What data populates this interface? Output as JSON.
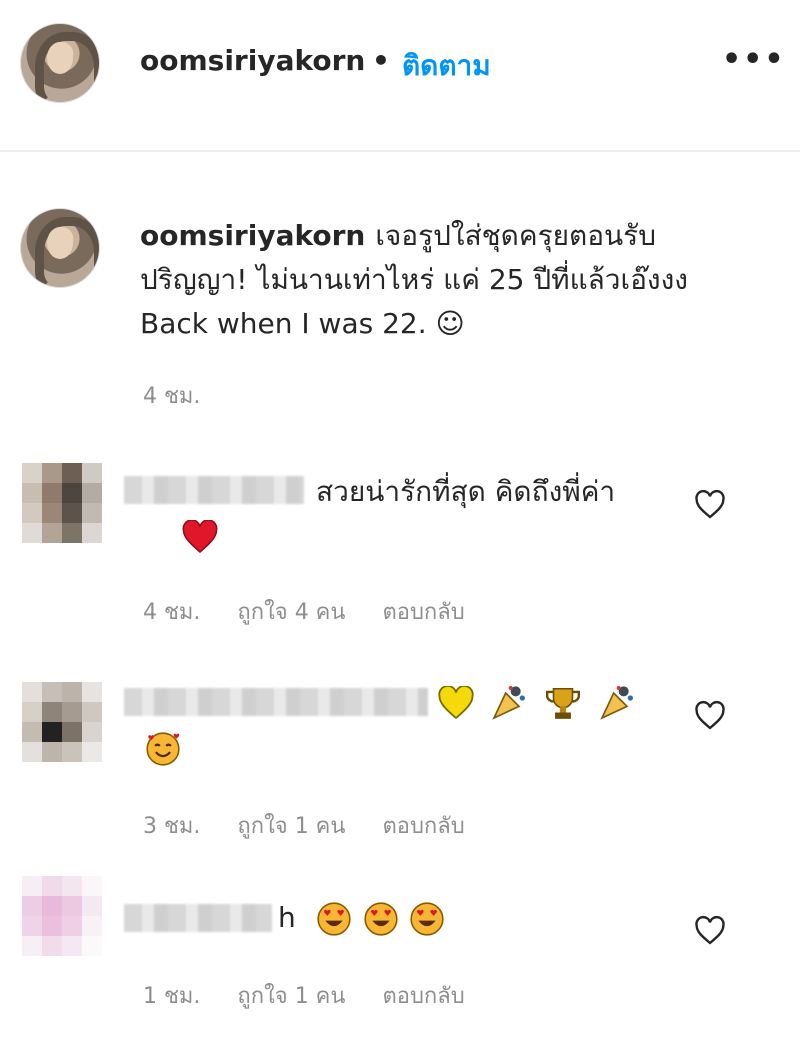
{
  "header": {
    "username": "oomsiriyakorn",
    "separator": "•",
    "follow_label": "ติดตาม",
    "more_label": "•••"
  },
  "caption": {
    "username": "oomsiriyakorn",
    "text": "เจอรูปใส่ชุดครุยตอนรับปริญญา! ไม่นานเท่าไหร่ แค่ 25 ปีที่แล้วเอ๊งงง Back when I was 22. ☺",
    "time": "4 ชม."
  },
  "comments": [
    {
      "text": "สวยน่ารักที่สุด คิดถึงพี่ค่า",
      "emoji": "❤️",
      "time": "4 ชม.",
      "likes": "ถูกใจ 4 คน",
      "reply": "ตอบกลับ"
    },
    {
      "text": "",
      "emoji": "💛 🎉 🏆 🎉 🥰",
      "time": "3 ชม.",
      "likes": "ถูกใจ 1 คน",
      "reply": "ตอบกลับ"
    },
    {
      "text": "h",
      "emoji": "😍 😍 😍",
      "time": "1 ชม.",
      "likes": "ถูกใจ 1 คน",
      "reply": "ตอบกลับ"
    }
  ],
  "icons": {
    "like": "heart-outline-icon",
    "more": "more-options-icon"
  },
  "colors": {
    "follow": "#0095f6",
    "muted": "#8e8e8e",
    "text": "#262626",
    "divider": "#efefef"
  }
}
